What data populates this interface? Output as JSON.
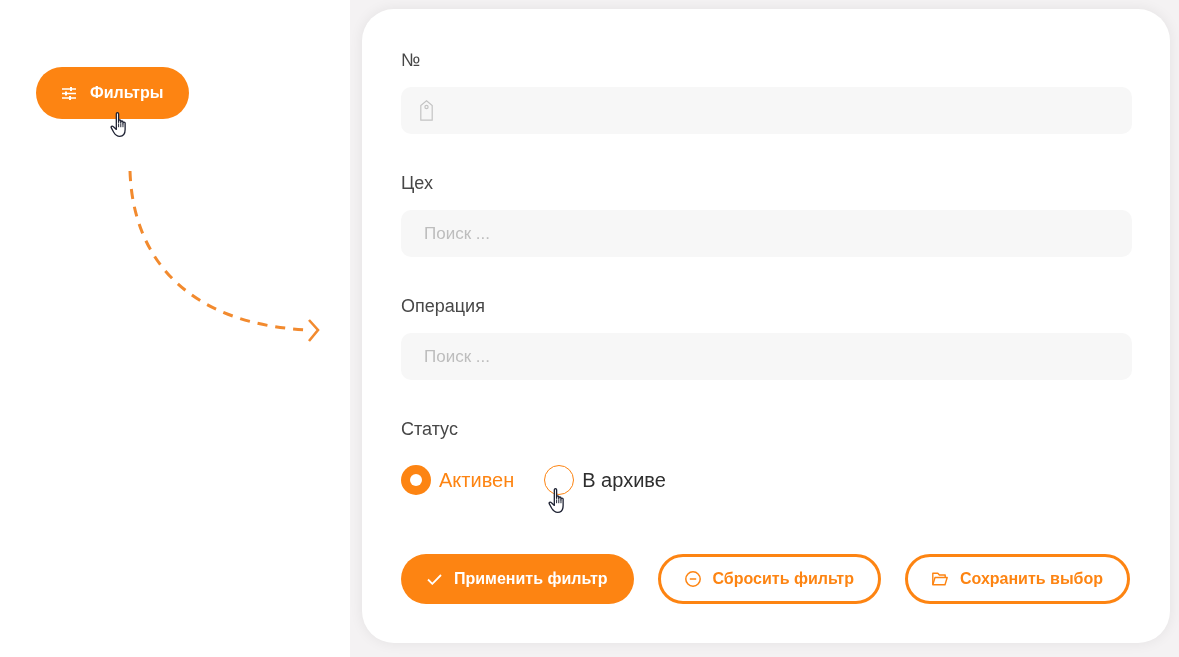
{
  "filter_button": {
    "label": "Фильтры"
  },
  "form": {
    "fields": [
      {
        "label": "№",
        "kind": "number"
      },
      {
        "label": "Цех",
        "kind": "search",
        "placeholder": "Поиск ..."
      },
      {
        "label": "Операция",
        "kind": "search",
        "placeholder": "Поиск ..."
      }
    ],
    "status": {
      "label": "Статус",
      "options": [
        {
          "label": "Активен",
          "selected": true
        },
        {
          "label": "В архиве",
          "selected": false
        }
      ]
    },
    "buttons": [
      {
        "label": "Применить фильтр",
        "kind": "primary"
      },
      {
        "label": "Сбросить фильтр",
        "kind": "outline"
      },
      {
        "label": "Сохранить выбор",
        "kind": "outline"
      }
    ]
  }
}
